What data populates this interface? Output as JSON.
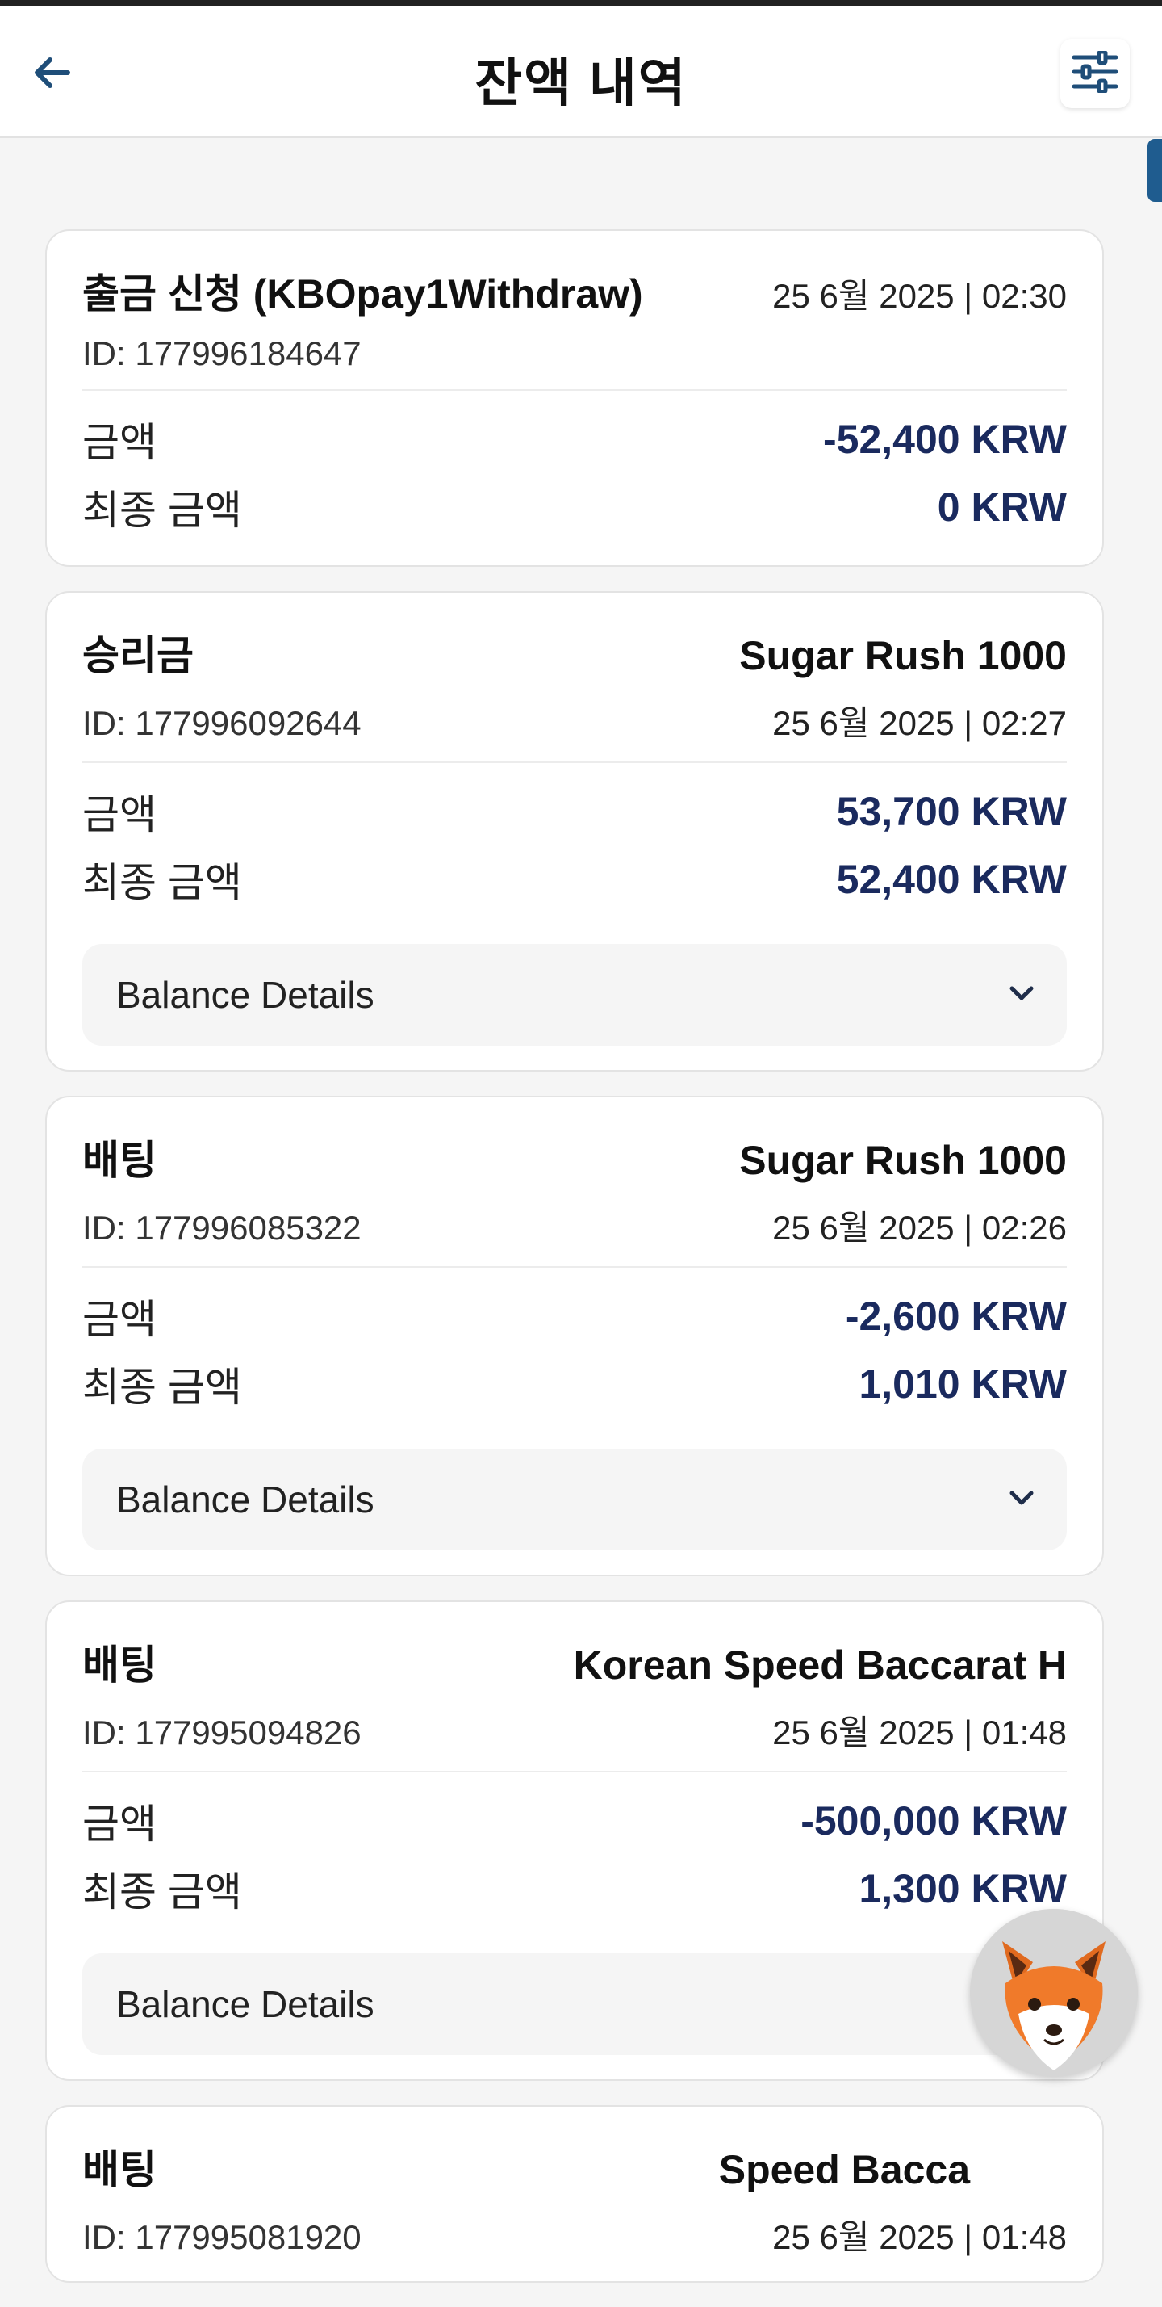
{
  "header": {
    "title": "잔액 내역"
  },
  "transactions": [
    {
      "type": "출금 신청 (KBOpay1Withdraw)",
      "game": "",
      "id": "ID: 177996184647",
      "datetime": "25 6월 2025 | 02:30",
      "amount_label": "금액",
      "amount": "-52,400 KRW",
      "final_label": "최종 금액",
      "final": "0 KRW",
      "details_label": ""
    },
    {
      "type": "승리금",
      "game": "Sugar Rush 1000",
      "id": "ID: 177996092644",
      "datetime": "25 6월 2025 | 02:27",
      "amount_label": "금액",
      "amount": "53,700 KRW",
      "final_label": "최종 금액",
      "final": "52,400 KRW",
      "details_label": "Balance Details"
    },
    {
      "type": "배팅",
      "game": "Sugar Rush 1000",
      "id": "ID: 177996085322",
      "datetime": "25 6월 2025 | 02:26",
      "amount_label": "금액",
      "amount": "-2,600 KRW",
      "final_label": "최종 금액",
      "final": "1,010 KRW",
      "details_label": "Balance Details"
    },
    {
      "type": "배팅",
      "game": "Korean Speed Baccarat H",
      "id": "ID: 177995094826",
      "datetime": "25 6월 2025 | 01:48",
      "amount_label": "금액",
      "amount": "-500,000 KRW",
      "final_label": "최종 금액",
      "final": "1,300 KRW",
      "details_label": "Balance Details"
    },
    {
      "type": "배팅",
      "game": "Speed Bacca",
      "id": "ID: 177995081920",
      "datetime": "25 6월 2025 | 01:48"
    }
  ],
  "icons": {
    "back": "arrow-left-icon",
    "filter": "sliders-icon",
    "chevron": "chevron-down-icon",
    "fox": "fox-avatar-icon"
  },
  "colors": {
    "amount": "#1a2a5e",
    "accent": "#1f5c8f",
    "card_bg": "#ffffff",
    "page_bg": "#f5f5f5"
  }
}
